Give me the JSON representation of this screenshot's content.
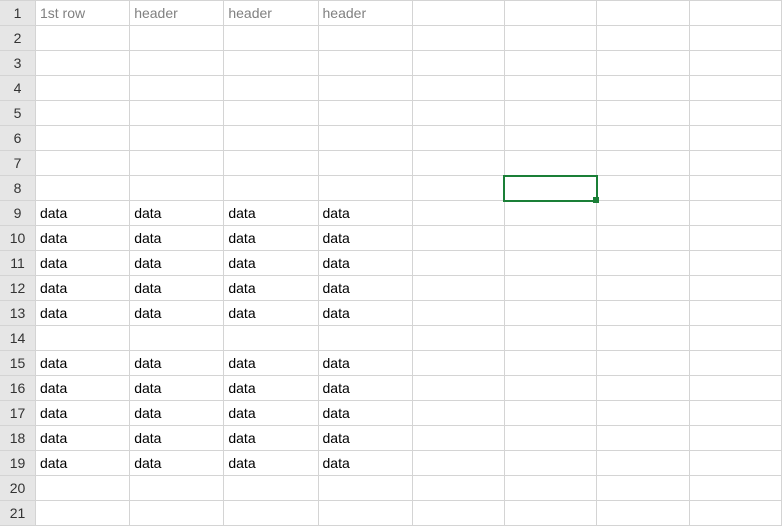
{
  "columns": 8,
  "rows": 21,
  "selected": {
    "row": 8,
    "col": 5
  },
  "header_row_index": 1,
  "cells": {
    "r1": [
      "1st row",
      "header",
      "header",
      "header",
      "",
      "",
      "",
      ""
    ],
    "r2": [
      "",
      "",
      "",
      "",
      "",
      "",
      "",
      ""
    ],
    "r3": [
      "",
      "",
      "",
      "",
      "",
      "",
      "",
      ""
    ],
    "r4": [
      "",
      "",
      "",
      "",
      "",
      "",
      "",
      ""
    ],
    "r5": [
      "",
      "",
      "",
      "",
      "",
      "",
      "",
      ""
    ],
    "r6": [
      "",
      "",
      "",
      "",
      "",
      "",
      "",
      ""
    ],
    "r7": [
      "",
      "",
      "",
      "",
      "",
      "",
      "",
      ""
    ],
    "r8": [
      "",
      "",
      "",
      "",
      "",
      "",
      "",
      ""
    ],
    "r9": [
      "data",
      "data",
      "data",
      "data",
      "",
      "",
      "",
      ""
    ],
    "r10": [
      "data",
      "data",
      "data",
      "data",
      "",
      "",
      "",
      ""
    ],
    "r11": [
      "data",
      "data",
      "data",
      "data",
      "",
      "",
      "",
      ""
    ],
    "r12": [
      "data",
      "data",
      "data",
      "data",
      "",
      "",
      "",
      ""
    ],
    "r13": [
      "data",
      "data",
      "data",
      "data",
      "",
      "",
      "",
      ""
    ],
    "r14": [
      "",
      "",
      "",
      "",
      "",
      "",
      "",
      ""
    ],
    "r15": [
      "data",
      "data",
      "data",
      "data",
      "",
      "",
      "",
      ""
    ],
    "r16": [
      "data",
      "data",
      "data",
      "data",
      "",
      "",
      "",
      ""
    ],
    "r17": [
      "data",
      "data",
      "data",
      "data",
      "",
      "",
      "",
      ""
    ],
    "r18": [
      "data",
      "data",
      "data",
      "data",
      "",
      "",
      "",
      ""
    ],
    "r19": [
      "data",
      "data",
      "data",
      "data",
      "",
      "",
      "",
      ""
    ],
    "r20": [
      "",
      "",
      "",
      "",
      "",
      "",
      "",
      ""
    ],
    "r21": [
      "",
      "",
      "",
      "",
      "",
      "",
      "",
      ""
    ]
  }
}
